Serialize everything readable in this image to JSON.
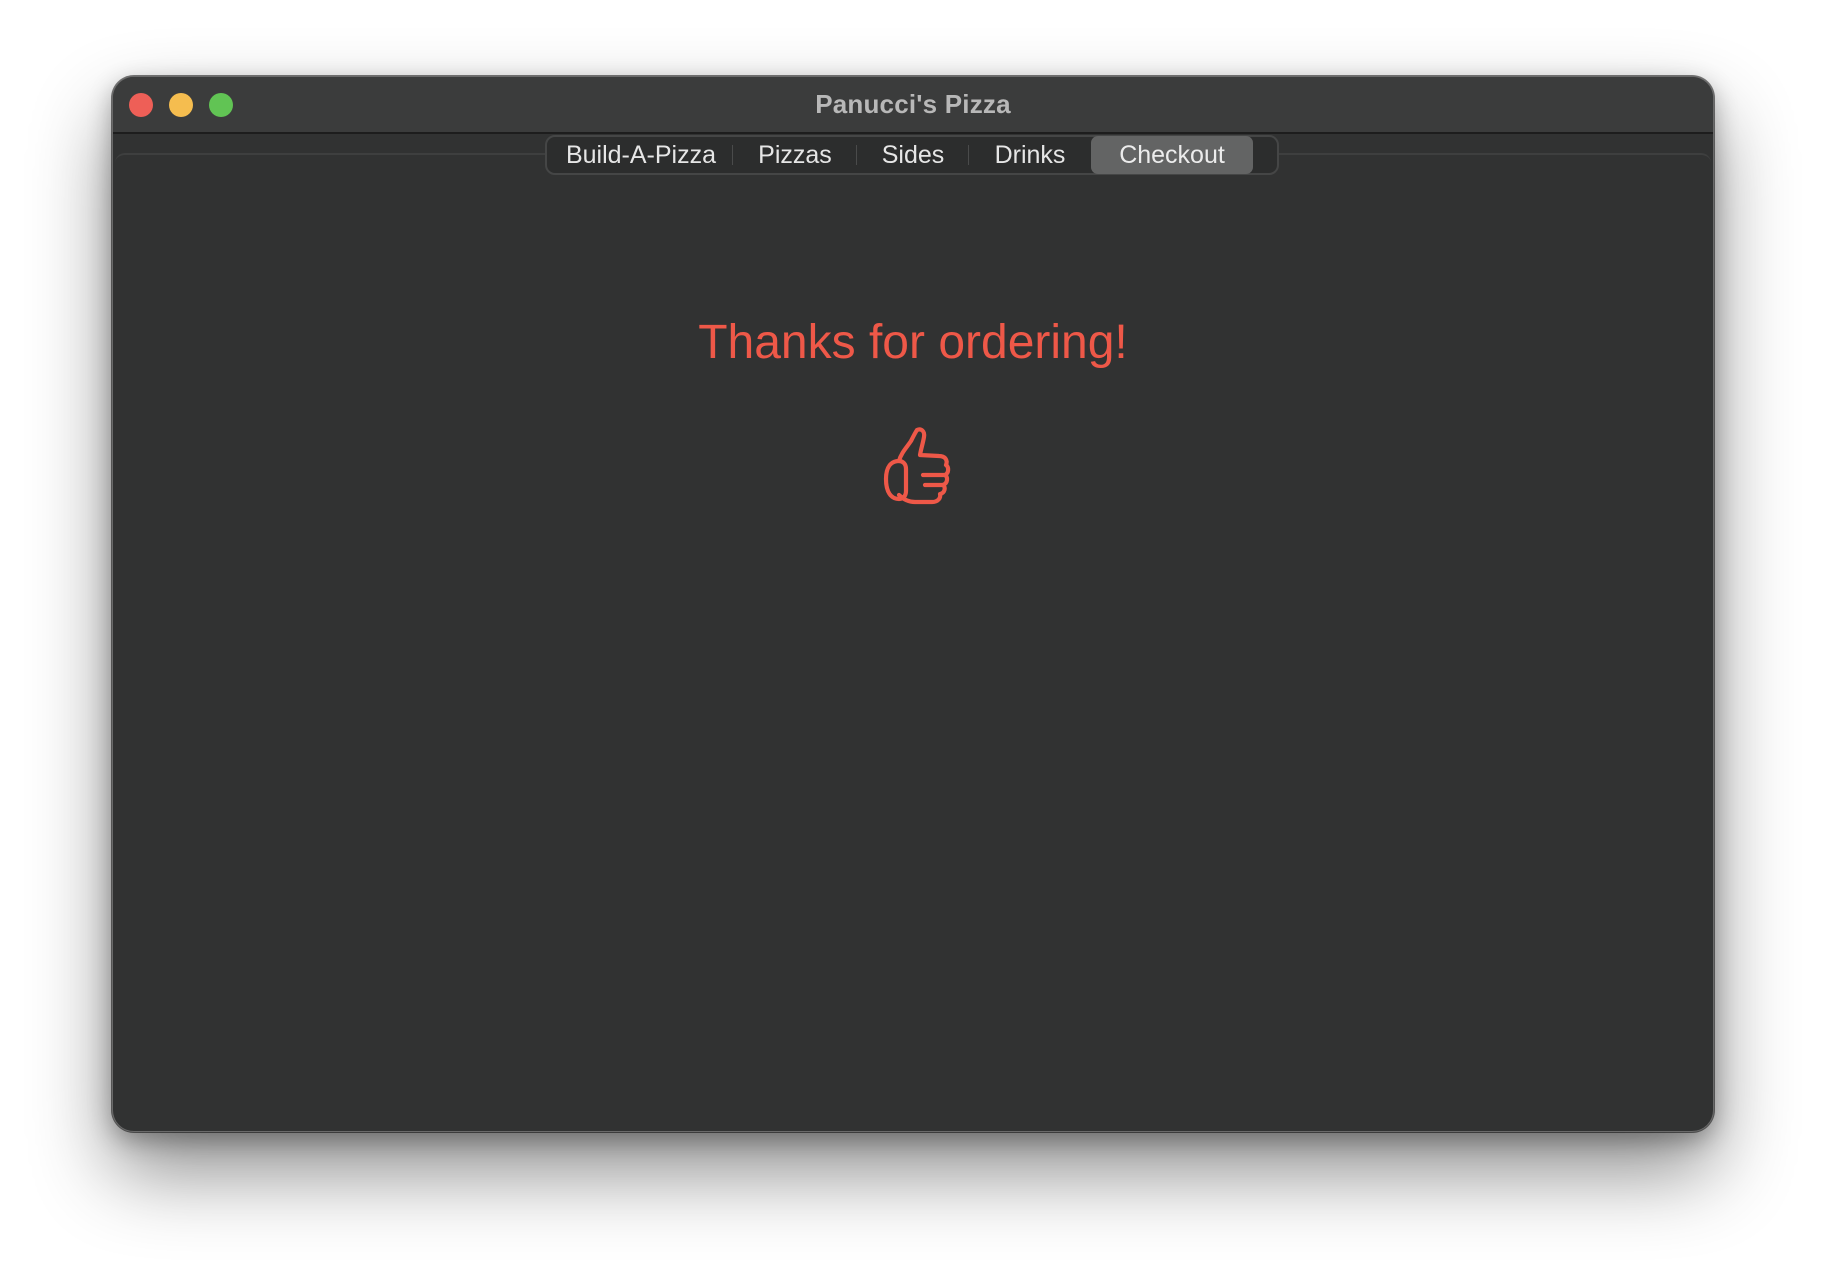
{
  "window": {
    "title": "Panucci's Pizza",
    "traffic_colors": {
      "close": "#ee5f57",
      "minimize": "#f5bd4f",
      "zoom": "#61c454"
    }
  },
  "tabs": [
    {
      "label": "Build-A-Pizza",
      "selected": false
    },
    {
      "label": "Pizzas",
      "selected": false
    },
    {
      "label": "Sides",
      "selected": false
    },
    {
      "label": "Drinks",
      "selected": false
    },
    {
      "label": "Checkout",
      "selected": true
    }
  ],
  "checkout": {
    "message": "Thanks for ordering!",
    "icon": "thumbs-up-icon",
    "accent_color": "#ee5848"
  }
}
